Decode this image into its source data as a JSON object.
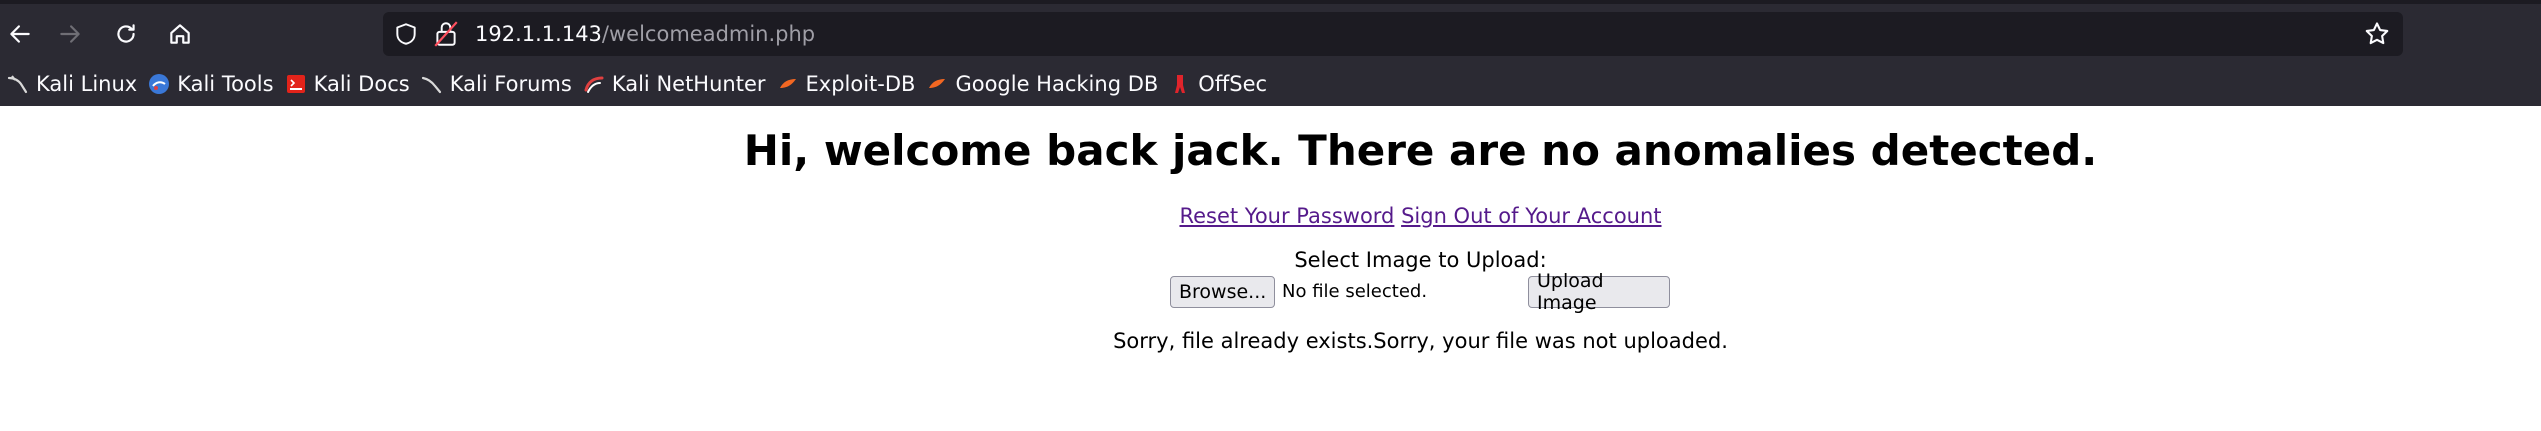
{
  "browser": {
    "url_host": "192.1.1.143",
    "url_path": "/welcomeadmin.php"
  },
  "bookmarks": [
    {
      "label": "Kali Linux",
      "icon": "kali-dragon-icon"
    },
    {
      "label": "Kali Tools",
      "icon": "kali-tools-icon"
    },
    {
      "label": "Kali Docs",
      "icon": "kali-docs-icon"
    },
    {
      "label": "Kali Forums",
      "icon": "kali-forums-icon"
    },
    {
      "label": "Kali NetHunter",
      "icon": "kali-nethunter-icon"
    },
    {
      "label": "Exploit-DB",
      "icon": "exploit-db-icon"
    },
    {
      "label": "Google Hacking DB",
      "icon": "google-hacking-db-icon"
    },
    {
      "label": "OffSec",
      "icon": "offsec-icon"
    }
  ],
  "page": {
    "heading": "Hi, welcome back jack. There are no anomalies detected.",
    "reset_link": "Reset Your Password",
    "signout_link": "Sign Out of Your Account",
    "upload_label": "Select Image to Upload:",
    "browse_label": "Browse...",
    "no_file_text": "No file selected.",
    "upload_button": "Upload Image",
    "message": "Sorry, file already exists.Sorry, your file was not uploaded."
  },
  "colors": {
    "chrome_bg": "#2b2a33",
    "urlbar_bg": "#1c1b22",
    "link_visited": "#551a8b"
  }
}
